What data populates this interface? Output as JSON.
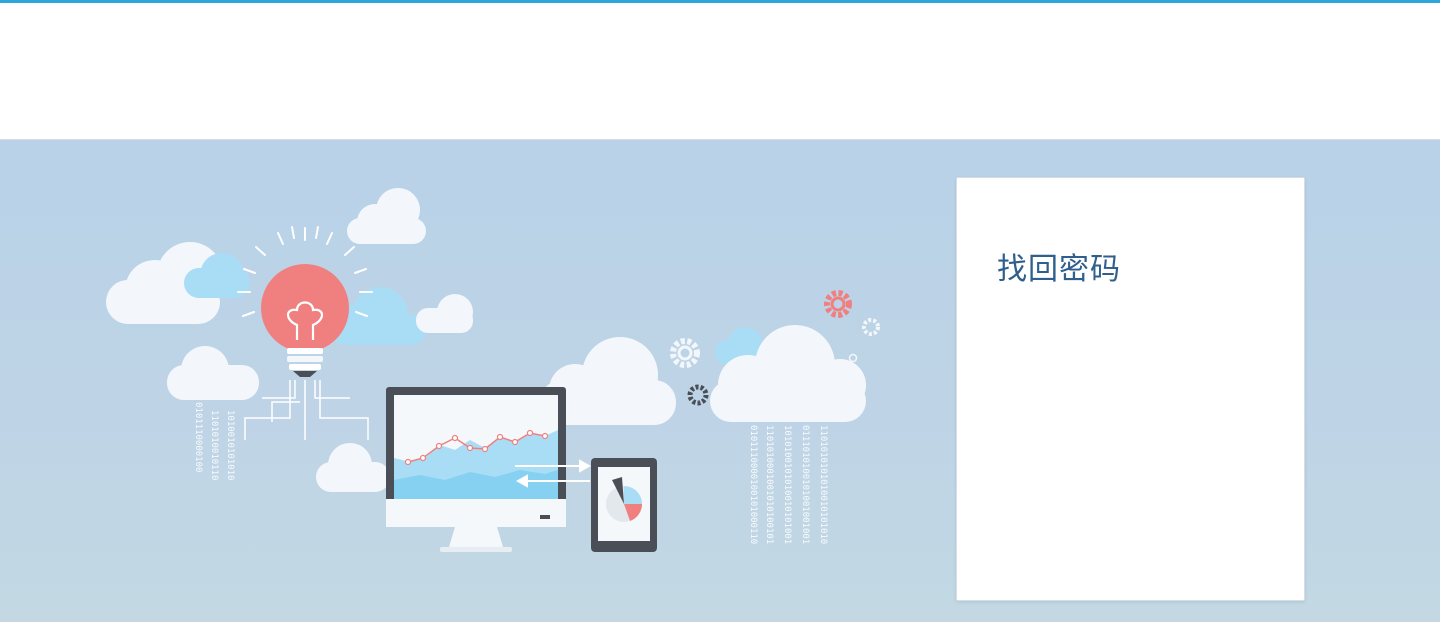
{
  "card": {
    "title": "找回密码"
  },
  "binary_left": [
    "1010010101010",
    "1101010010110",
    "0101110000100"
  ],
  "binary_right": [
    "1101010101010010101010",
    "0111010100101001001001",
    "1010100101010010101001",
    "1101010001001010100101",
    "0101110000100101000110"
  ],
  "colors": {
    "accent": "#2ea6d8",
    "title": "#2f5f8c",
    "bulb": "#f08080",
    "cloud_blue": "#a9dcf5"
  }
}
